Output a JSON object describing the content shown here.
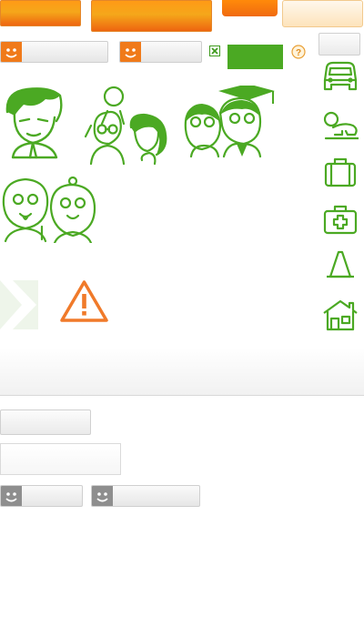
{
  "top_tabs": [
    {
      "label": ""
    },
    {
      "label": ""
    },
    {
      "label": ""
    },
    {
      "label": ""
    }
  ],
  "fields": {
    "smiley_input_1": {
      "value": "",
      "placeholder": ""
    },
    "smiley_input_2": {
      "value": "",
      "placeholder": ""
    },
    "smiley_input_3": {
      "value": "",
      "placeholder": ""
    },
    "smiley_input_4": {
      "value": "",
      "placeholder": ""
    },
    "text_box": {
      "value": "",
      "placeholder": ""
    }
  },
  "buttons": {
    "green_label": "",
    "grey_top_label": "",
    "grey_bottom_label": ""
  },
  "illustrations": [
    {
      "icon": "young-man-icon"
    },
    {
      "icon": "family-icon"
    },
    {
      "icon": "graduates-icon"
    },
    {
      "icon": "elderly-couple-icon"
    }
  ],
  "side_icons": [
    {
      "icon": "car-icon"
    },
    {
      "icon": "baby-crawling-icon"
    },
    {
      "icon": "suitcase-icon"
    },
    {
      "icon": "first-aid-kit-icon"
    },
    {
      "icon": "traffic-cone-icon"
    },
    {
      "icon": "house-icon"
    }
  ],
  "colors": {
    "brand_orange": "#f07010",
    "brand_green": "#4ba923",
    "warning": "#f07a2a"
  }
}
